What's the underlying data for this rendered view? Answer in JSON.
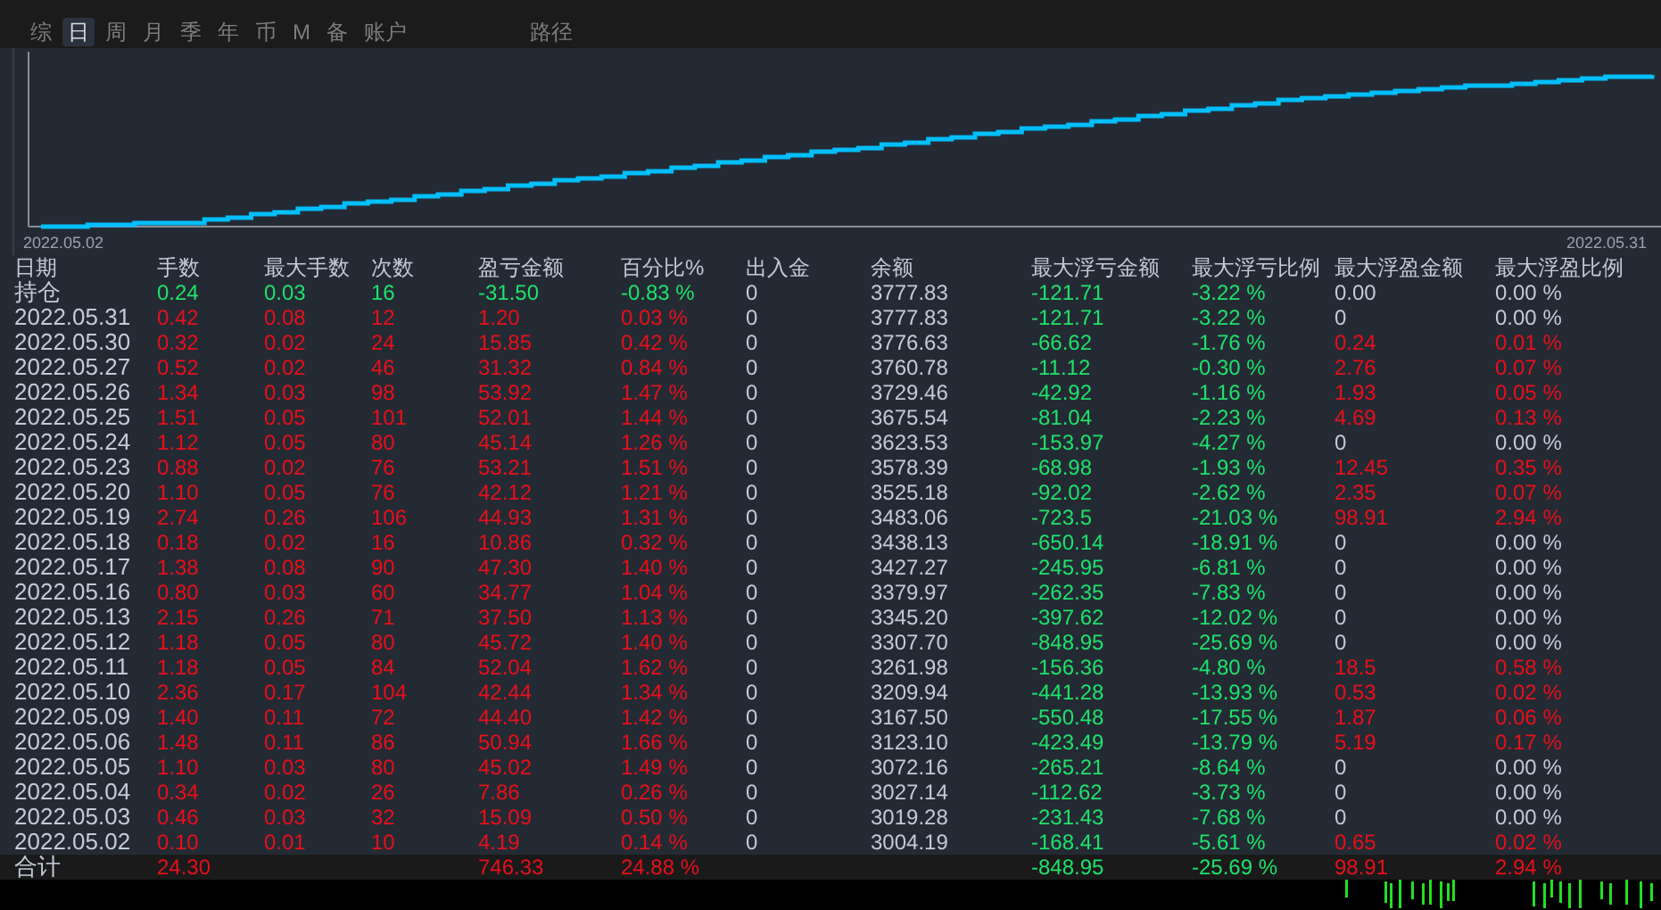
{
  "tabs": [
    {
      "label": "综",
      "selected": false
    },
    {
      "label": "日",
      "selected": true
    },
    {
      "label": "周",
      "selected": false
    },
    {
      "label": "月",
      "selected": false
    },
    {
      "label": "季",
      "selected": false
    },
    {
      "label": "年",
      "selected": false
    },
    {
      "label": "币",
      "selected": false
    },
    {
      "label": "M",
      "selected": false
    },
    {
      "label": "备",
      "selected": false
    },
    {
      "label": "账户",
      "selected": false
    },
    {
      "label": "路径",
      "selected": false
    }
  ],
  "chart": {
    "start_label": "2022.05.02",
    "end_label": "2022.05.31"
  },
  "table": {
    "columns": [
      {
        "label": "日期",
        "kind": "plain"
      },
      {
        "label": "手数",
        "kind": "trade"
      },
      {
        "label": "最大手数",
        "kind": "trade"
      },
      {
        "label": "次数",
        "kind": "trade"
      },
      {
        "label": "盈亏金额",
        "kind": "trade"
      },
      {
        "label": "百分比%",
        "kind": "trade"
      },
      {
        "label": "出入金",
        "kind": "plain"
      },
      {
        "label": "余额",
        "kind": "plain"
      },
      {
        "label": "最大浮亏金额",
        "kind": "drawdown"
      },
      {
        "label": "最大浮亏比例",
        "kind": "drawdown"
      },
      {
        "label": "最大浮盈金额",
        "kind": "runup"
      },
      {
        "label": "最大浮盈比例",
        "kind": "runup"
      }
    ],
    "rows": [
      {
        "trade_profit": false,
        "float_profit": false,
        "cells": [
          "持仓",
          "0.24",
          "0.03",
          "16",
          "-31.50",
          "-0.83 %",
          "0",
          "3777.83",
          "-121.71",
          "-3.22 %",
          "0.00",
          "0.00 %"
        ]
      },
      {
        "trade_profit": true,
        "float_profit": false,
        "cells": [
          "2022.05.31",
          "0.42",
          "0.08",
          "12",
          "1.20",
          "0.03 %",
          "0",
          "3777.83",
          "-121.71",
          "-3.22 %",
          "0",
          "0.00 %"
        ]
      },
      {
        "trade_profit": true,
        "float_profit": true,
        "cells": [
          "2022.05.30",
          "0.32",
          "0.02",
          "24",
          "15.85",
          "0.42 %",
          "0",
          "3776.63",
          "-66.62",
          "-1.76 %",
          "0.24",
          "0.01 %"
        ]
      },
      {
        "trade_profit": true,
        "float_profit": true,
        "cells": [
          "2022.05.27",
          "0.52",
          "0.02",
          "46",
          "31.32",
          "0.84 %",
          "0",
          "3760.78",
          "-11.12",
          "-0.30 %",
          "2.76",
          "0.07 %"
        ]
      },
      {
        "trade_profit": true,
        "float_profit": true,
        "cells": [
          "2022.05.26",
          "1.34",
          "0.03",
          "98",
          "53.92",
          "1.47 %",
          "0",
          "3729.46",
          "-42.92",
          "-1.16 %",
          "1.93",
          "0.05 %"
        ]
      },
      {
        "trade_profit": true,
        "float_profit": true,
        "cells": [
          "2022.05.25",
          "1.51",
          "0.05",
          "101",
          "52.01",
          "1.44 %",
          "0",
          "3675.54",
          "-81.04",
          "-2.23 %",
          "4.69",
          "0.13 %"
        ]
      },
      {
        "trade_profit": true,
        "float_profit": false,
        "cells": [
          "2022.05.24",
          "1.12",
          "0.05",
          "80",
          "45.14",
          "1.26 %",
          "0",
          "3623.53",
          "-153.97",
          "-4.27 %",
          "0",
          "0.00 %"
        ]
      },
      {
        "trade_profit": true,
        "float_profit": true,
        "cells": [
          "2022.05.23",
          "0.88",
          "0.02",
          "76",
          "53.21",
          "1.51 %",
          "0",
          "3578.39",
          "-68.98",
          "-1.93 %",
          "12.45",
          "0.35 %"
        ]
      },
      {
        "trade_profit": true,
        "float_profit": true,
        "cells": [
          "2022.05.20",
          "1.10",
          "0.05",
          "76",
          "42.12",
          "1.21 %",
          "0",
          "3525.18",
          "-92.02",
          "-2.62 %",
          "2.35",
          "0.07 %"
        ]
      },
      {
        "trade_profit": true,
        "float_profit": true,
        "cells": [
          "2022.05.19",
          "2.74",
          "0.26",
          "106",
          "44.93",
          "1.31 %",
          "0",
          "3483.06",
          "-723.5",
          "-21.03 %",
          "98.91",
          "2.94 %"
        ]
      },
      {
        "trade_profit": true,
        "float_profit": false,
        "cells": [
          "2022.05.18",
          "0.18",
          "0.02",
          "16",
          "10.86",
          "0.32 %",
          "0",
          "3438.13",
          "-650.14",
          "-18.91 %",
          "0",
          "0.00 %"
        ]
      },
      {
        "trade_profit": true,
        "float_profit": false,
        "cells": [
          "2022.05.17",
          "1.38",
          "0.08",
          "90",
          "47.30",
          "1.40 %",
          "0",
          "3427.27",
          "-245.95",
          "-6.81 %",
          "0",
          "0.00 %"
        ]
      },
      {
        "trade_profit": true,
        "float_profit": false,
        "cells": [
          "2022.05.16",
          "0.80",
          "0.03",
          "60",
          "34.77",
          "1.04 %",
          "0",
          "3379.97",
          "-262.35",
          "-7.83 %",
          "0",
          "0.00 %"
        ]
      },
      {
        "trade_profit": true,
        "float_profit": false,
        "cells": [
          "2022.05.13",
          "2.15",
          "0.26",
          "71",
          "37.50",
          "1.13 %",
          "0",
          "3345.20",
          "-397.62",
          "-12.02 %",
          "0",
          "0.00 %"
        ]
      },
      {
        "trade_profit": true,
        "float_profit": false,
        "cells": [
          "2022.05.12",
          "1.18",
          "0.05",
          "80",
          "45.72",
          "1.40 %",
          "0",
          "3307.70",
          "-848.95",
          "-25.69 %",
          "0",
          "0.00 %"
        ]
      },
      {
        "trade_profit": true,
        "float_profit": true,
        "cells": [
          "2022.05.11",
          "1.18",
          "0.05",
          "84",
          "52.04",
          "1.62 %",
          "0",
          "3261.98",
          "-156.36",
          "-4.80 %",
          "18.5",
          "0.58 %"
        ]
      },
      {
        "trade_profit": true,
        "float_profit": true,
        "cells": [
          "2022.05.10",
          "2.36",
          "0.17",
          "104",
          "42.44",
          "1.34 %",
          "0",
          "3209.94",
          "-441.28",
          "-13.93 %",
          "0.53",
          "0.02 %"
        ]
      },
      {
        "trade_profit": true,
        "float_profit": true,
        "cells": [
          "2022.05.09",
          "1.40",
          "0.11",
          "72",
          "44.40",
          "1.42 %",
          "0",
          "3167.50",
          "-550.48",
          "-17.55 %",
          "1.87",
          "0.06 %"
        ]
      },
      {
        "trade_profit": true,
        "float_profit": true,
        "cells": [
          "2022.05.06",
          "1.48",
          "0.11",
          "86",
          "50.94",
          "1.66 %",
          "0",
          "3123.10",
          "-423.49",
          "-13.79 %",
          "5.19",
          "0.17 %"
        ]
      },
      {
        "trade_profit": true,
        "float_profit": false,
        "cells": [
          "2022.05.05",
          "1.10",
          "0.03",
          "80",
          "45.02",
          "1.49 %",
          "0",
          "3072.16",
          "-265.21",
          "-8.64 %",
          "0",
          "0.00 %"
        ]
      },
      {
        "trade_profit": true,
        "float_profit": false,
        "cells": [
          "2022.05.04",
          "0.34",
          "0.02",
          "26",
          "7.86",
          "0.26 %",
          "0",
          "3027.14",
          "-112.62",
          "-3.73 %",
          "0",
          "0.00 %"
        ]
      },
      {
        "trade_profit": true,
        "float_profit": false,
        "cells": [
          "2022.05.03",
          "0.46",
          "0.03",
          "32",
          "15.09",
          "0.50 %",
          "0",
          "3019.28",
          "-231.43",
          "-7.68 %",
          "0",
          "0.00 %"
        ]
      },
      {
        "trade_profit": true,
        "float_profit": true,
        "cells": [
          "2022.05.02",
          "0.10",
          "0.01",
          "10",
          "4.19",
          "0.14 %",
          "0",
          "3004.19",
          "-168.41",
          "-5.61 %",
          "0.65",
          "0.02 %"
        ]
      }
    ],
    "total": {
      "trade_profit": true,
      "float_profit": true,
      "cells": [
        "合计",
        "24.30",
        null,
        null,
        "746.33",
        "24.88 %",
        null,
        null,
        "-848.95",
        "-25.69 %",
        "98.91",
        "2.94 %"
      ]
    }
  }
}
